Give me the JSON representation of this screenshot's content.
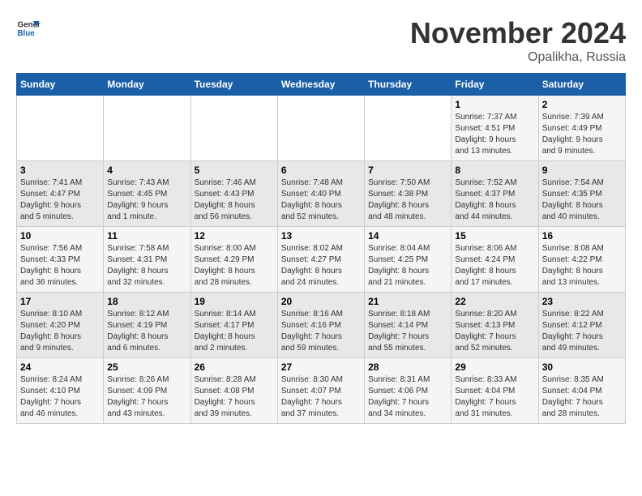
{
  "logo": {
    "line1": "General",
    "line2": "Blue"
  },
  "title": "November 2024",
  "location": "Opalikha, Russia",
  "days_of_week": [
    "Sunday",
    "Monday",
    "Tuesday",
    "Wednesday",
    "Thursday",
    "Friday",
    "Saturday"
  ],
  "weeks": [
    [
      {
        "day": "",
        "info": ""
      },
      {
        "day": "",
        "info": ""
      },
      {
        "day": "",
        "info": ""
      },
      {
        "day": "",
        "info": ""
      },
      {
        "day": "",
        "info": ""
      },
      {
        "day": "1",
        "info": "Sunrise: 7:37 AM\nSunset: 4:51 PM\nDaylight: 9 hours\nand 13 minutes."
      },
      {
        "day": "2",
        "info": "Sunrise: 7:39 AM\nSunset: 4:49 PM\nDaylight: 9 hours\nand 9 minutes."
      }
    ],
    [
      {
        "day": "3",
        "info": "Sunrise: 7:41 AM\nSunset: 4:47 PM\nDaylight: 9 hours\nand 5 minutes."
      },
      {
        "day": "4",
        "info": "Sunrise: 7:43 AM\nSunset: 4:45 PM\nDaylight: 9 hours\nand 1 minute."
      },
      {
        "day": "5",
        "info": "Sunrise: 7:46 AM\nSunset: 4:43 PM\nDaylight: 8 hours\nand 56 minutes."
      },
      {
        "day": "6",
        "info": "Sunrise: 7:48 AM\nSunset: 4:40 PM\nDaylight: 8 hours\nand 52 minutes."
      },
      {
        "day": "7",
        "info": "Sunrise: 7:50 AM\nSunset: 4:38 PM\nDaylight: 8 hours\nand 48 minutes."
      },
      {
        "day": "8",
        "info": "Sunrise: 7:52 AM\nSunset: 4:37 PM\nDaylight: 8 hours\nand 44 minutes."
      },
      {
        "day": "9",
        "info": "Sunrise: 7:54 AM\nSunset: 4:35 PM\nDaylight: 8 hours\nand 40 minutes."
      }
    ],
    [
      {
        "day": "10",
        "info": "Sunrise: 7:56 AM\nSunset: 4:33 PM\nDaylight: 8 hours\nand 36 minutes."
      },
      {
        "day": "11",
        "info": "Sunrise: 7:58 AM\nSunset: 4:31 PM\nDaylight: 8 hours\nand 32 minutes."
      },
      {
        "day": "12",
        "info": "Sunrise: 8:00 AM\nSunset: 4:29 PM\nDaylight: 8 hours\nand 28 minutes."
      },
      {
        "day": "13",
        "info": "Sunrise: 8:02 AM\nSunset: 4:27 PM\nDaylight: 8 hours\nand 24 minutes."
      },
      {
        "day": "14",
        "info": "Sunrise: 8:04 AM\nSunset: 4:25 PM\nDaylight: 8 hours\nand 21 minutes."
      },
      {
        "day": "15",
        "info": "Sunrise: 8:06 AM\nSunset: 4:24 PM\nDaylight: 8 hours\nand 17 minutes."
      },
      {
        "day": "16",
        "info": "Sunrise: 8:08 AM\nSunset: 4:22 PM\nDaylight: 8 hours\nand 13 minutes."
      }
    ],
    [
      {
        "day": "17",
        "info": "Sunrise: 8:10 AM\nSunset: 4:20 PM\nDaylight: 8 hours\nand 9 minutes."
      },
      {
        "day": "18",
        "info": "Sunrise: 8:12 AM\nSunset: 4:19 PM\nDaylight: 8 hours\nand 6 minutes."
      },
      {
        "day": "19",
        "info": "Sunrise: 8:14 AM\nSunset: 4:17 PM\nDaylight: 8 hours\nand 2 minutes."
      },
      {
        "day": "20",
        "info": "Sunrise: 8:16 AM\nSunset: 4:16 PM\nDaylight: 7 hours\nand 59 minutes."
      },
      {
        "day": "21",
        "info": "Sunrise: 8:18 AM\nSunset: 4:14 PM\nDaylight: 7 hours\nand 55 minutes."
      },
      {
        "day": "22",
        "info": "Sunrise: 8:20 AM\nSunset: 4:13 PM\nDaylight: 7 hours\nand 52 minutes."
      },
      {
        "day": "23",
        "info": "Sunrise: 8:22 AM\nSunset: 4:12 PM\nDaylight: 7 hours\nand 49 minutes."
      }
    ],
    [
      {
        "day": "24",
        "info": "Sunrise: 8:24 AM\nSunset: 4:10 PM\nDaylight: 7 hours\nand 46 minutes."
      },
      {
        "day": "25",
        "info": "Sunrise: 8:26 AM\nSunset: 4:09 PM\nDaylight: 7 hours\nand 43 minutes."
      },
      {
        "day": "26",
        "info": "Sunrise: 8:28 AM\nSunset: 4:08 PM\nDaylight: 7 hours\nand 39 minutes."
      },
      {
        "day": "27",
        "info": "Sunrise: 8:30 AM\nSunset: 4:07 PM\nDaylight: 7 hours\nand 37 minutes."
      },
      {
        "day": "28",
        "info": "Sunrise: 8:31 AM\nSunset: 4:06 PM\nDaylight: 7 hours\nand 34 minutes."
      },
      {
        "day": "29",
        "info": "Sunrise: 8:33 AM\nSunset: 4:04 PM\nDaylight: 7 hours\nand 31 minutes."
      },
      {
        "day": "30",
        "info": "Sunrise: 8:35 AM\nSunset: 4:04 PM\nDaylight: 7 hours\nand 28 minutes."
      }
    ]
  ]
}
